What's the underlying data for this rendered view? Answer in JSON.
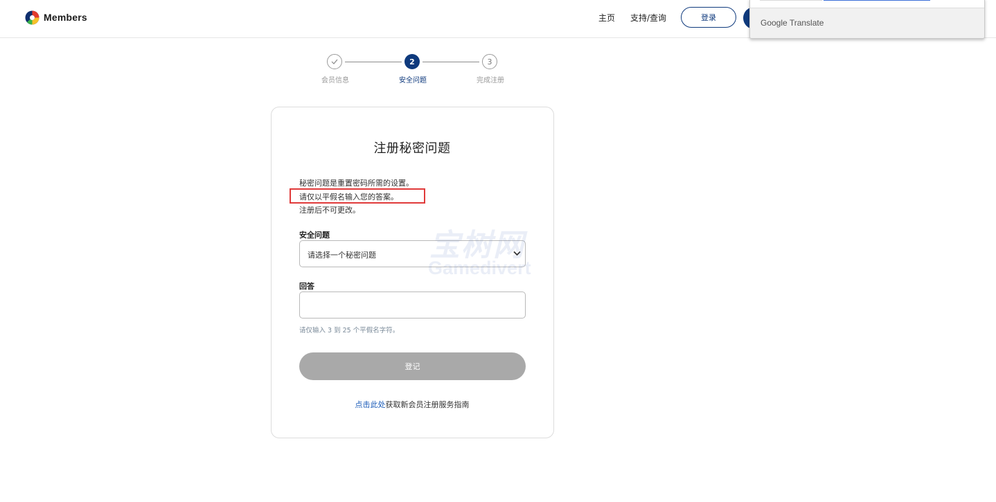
{
  "header": {
    "brand": "Members",
    "nav": {
      "home": "主页",
      "support": "支持/查询"
    },
    "login_label": "登录"
  },
  "translate": {
    "label": "Google Translate"
  },
  "steps": [
    {
      "number": "",
      "label": "会员信息",
      "state": "completed"
    },
    {
      "number": "2",
      "label": "安全问题",
      "state": "active"
    },
    {
      "number": "3",
      "label": "完成注册",
      "state": "pending"
    }
  ],
  "form": {
    "title": "注册秘密问题",
    "descriptions": [
      "秘密问题是重置密码所需的设置。",
      "请仅以平假名输入您的答案。",
      "注册后不可更改。"
    ],
    "question_label": "安全问题",
    "question_selected": "请选择一个秘密问题",
    "answer_label": "回答",
    "answer_value": "",
    "hint": "请仅输入 3 到 25 个平假名字符。",
    "submit_label": "登记",
    "footer_link": "点击此处",
    "footer_text": "获取新会员注册服务指南"
  },
  "watermark": {
    "cn": "宝树网",
    "en": "Gamedivert"
  },
  "colors": {
    "primary": "#0f3a7d",
    "disabled_button": "#a9a9a9",
    "highlight": "#e03a3a",
    "link": "#1a5bb8"
  }
}
